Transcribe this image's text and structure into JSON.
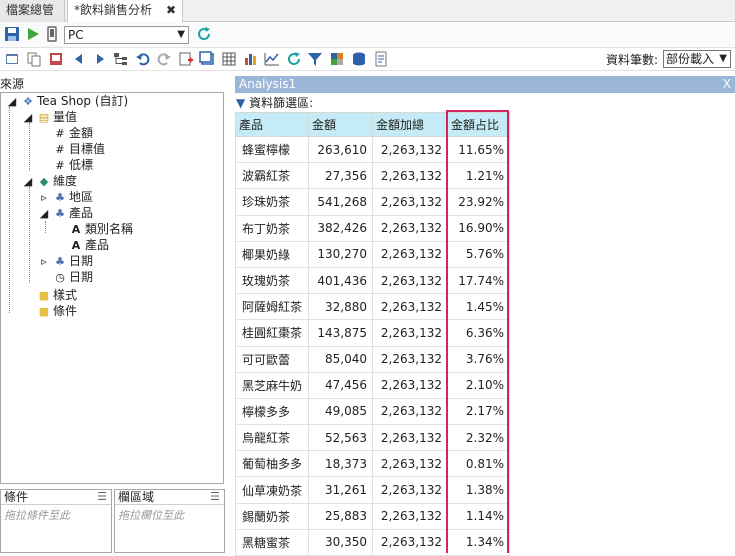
{
  "tabs": [
    {
      "label": "檔案總管"
    },
    {
      "label": "*飲料銷售分析",
      "close": "✖"
    }
  ],
  "toolbar": {
    "device": "PC"
  },
  "options": {
    "rowcount_label": "資料筆數:",
    "load_mode": "部份載入"
  },
  "left": {
    "source_label": "來源",
    "tree": {
      "root": "Tea Shop (自訂)",
      "measures_label": "量值",
      "measures": [
        "金額",
        "目標值",
        "低標"
      ],
      "dimensions_label": "維度",
      "region": "地區",
      "product": "產品",
      "product_children": [
        "類別名稱",
        "產品"
      ],
      "date": "日期",
      "date_child": "日期",
      "style": "樣式",
      "condition": "條件"
    },
    "cond_box": {
      "title": "條件",
      "hint": "拖拉條件至此"
    },
    "cols_box": {
      "title": "欄區域",
      "hint": "拖拉欄位至此"
    }
  },
  "analysis": {
    "title": "Analysis1",
    "close": "X",
    "filter_label": "資料篩選區:",
    "columns": [
      "產品",
      "金額",
      "金額加總",
      "金額占比"
    ],
    "rows": [
      [
        "蜂蜜檸檬",
        "263,610",
        "2,263,132",
        "11.65%"
      ],
      [
        "波霸紅茶",
        "27,356",
        "2,263,132",
        "1.21%"
      ],
      [
        "珍珠奶茶",
        "541,268",
        "2,263,132",
        "23.92%"
      ],
      [
        "布丁奶茶",
        "382,426",
        "2,263,132",
        "16.90%"
      ],
      [
        "椰果奶綠",
        "130,270",
        "2,263,132",
        "5.76%"
      ],
      [
        "玫瑰奶茶",
        "401,436",
        "2,263,132",
        "17.74%"
      ],
      [
        "阿薩姆紅茶",
        "32,880",
        "2,263,132",
        "1.45%"
      ],
      [
        "桂圓紅棗茶",
        "143,875",
        "2,263,132",
        "6.36%"
      ],
      [
        "可可歐蕾",
        "85,040",
        "2,263,132",
        "3.76%"
      ],
      [
        "黑芝麻牛奶",
        "47,456",
        "2,263,132",
        "2.10%"
      ],
      [
        "檸檬多多",
        "49,085",
        "2,263,132",
        "2.17%"
      ],
      [
        "烏龍紅茶",
        "52,563",
        "2,263,132",
        "2.32%"
      ],
      [
        "葡萄柚多多",
        "18,373",
        "2,263,132",
        "0.81%"
      ],
      [
        "仙草凍奶茶",
        "31,261",
        "2,263,132",
        "1.38%"
      ],
      [
        "錫蘭奶茶",
        "25,883",
        "2,263,132",
        "1.14%"
      ],
      [
        "黑糖蜜茶",
        "30,350",
        "2,263,132",
        "1.34%"
      ]
    ]
  },
  "colors": {
    "header_bg": "#c5ecf6",
    "panel_title_bg": "#9ab6d8",
    "highlight": "#d6225f"
  }
}
